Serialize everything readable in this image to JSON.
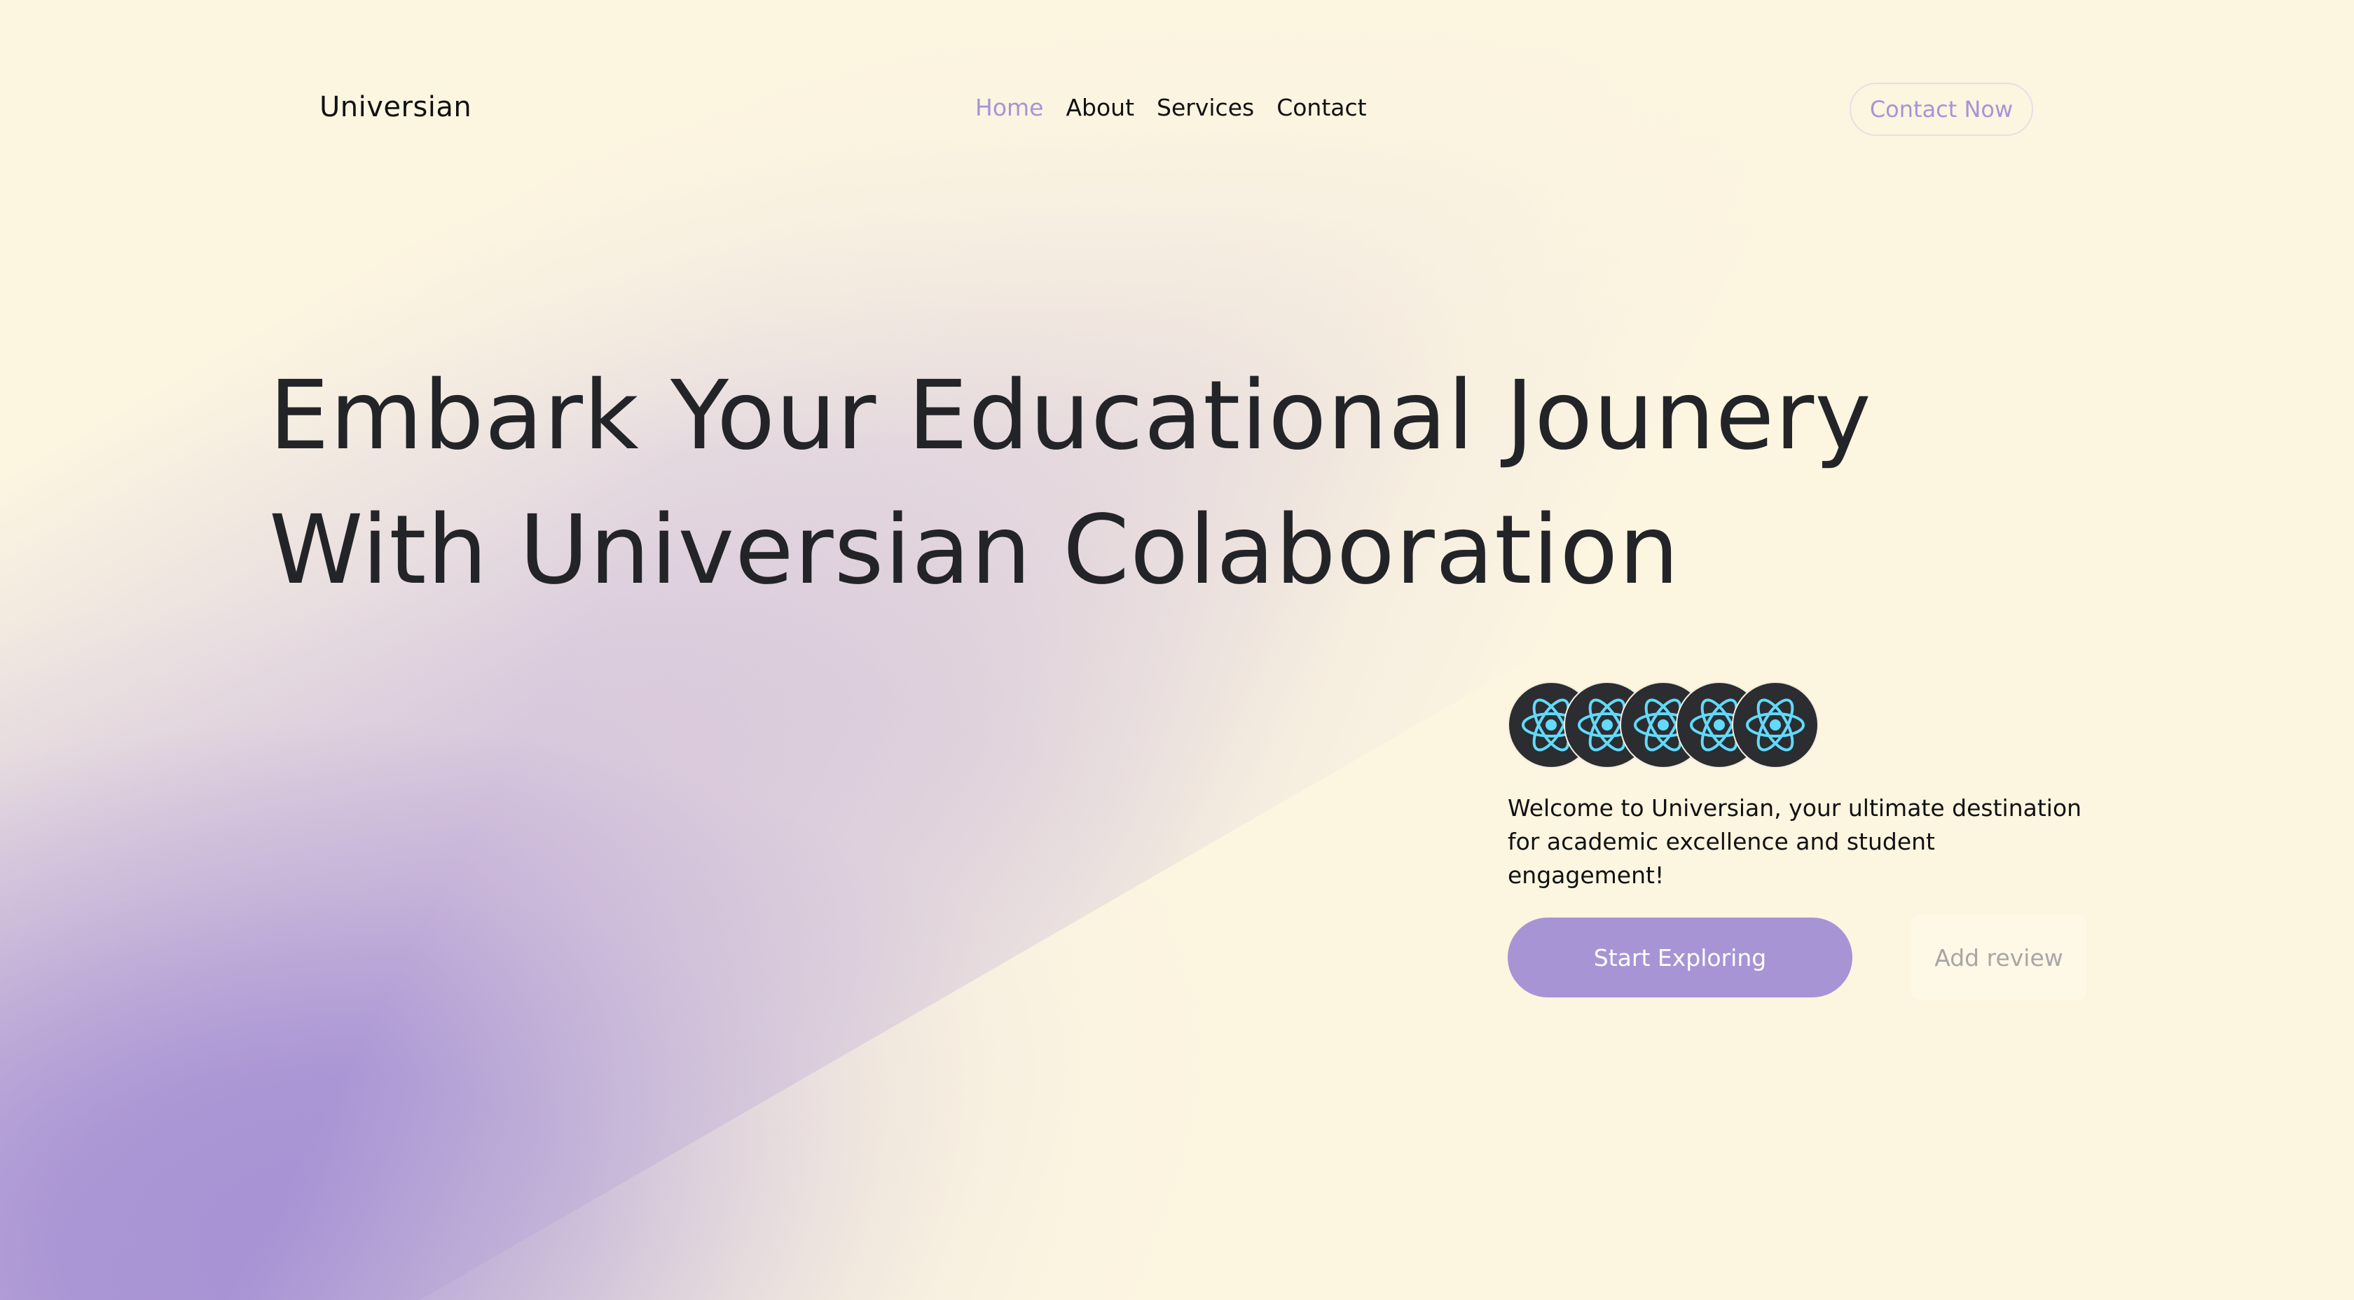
{
  "nav": {
    "brand": "Universian",
    "items": [
      {
        "label": "Home",
        "active": true
      },
      {
        "label": "About",
        "active": false
      },
      {
        "label": "Services",
        "active": false
      },
      {
        "label": "Contact",
        "active": false
      }
    ],
    "cta_label": "Contact Now"
  },
  "hero": {
    "title_line1": "Embark Your Educational Jounery",
    "title_line2": "With Universian Colaboration"
  },
  "reviewers": {
    "avatar_icon": "react-atom-icon",
    "count": 5
  },
  "intro": {
    "text": "Welcome to Universian, your ultimate destination for academic excellence and student engagement!",
    "primary_label": "Start Exploring",
    "secondary_label": "Add review"
  },
  "colors": {
    "accent": "#a794d4",
    "background": "#fcf5e0",
    "text": "#222428",
    "avatar_bg": "#2b2d31",
    "react_cyan": "#61dafb"
  }
}
